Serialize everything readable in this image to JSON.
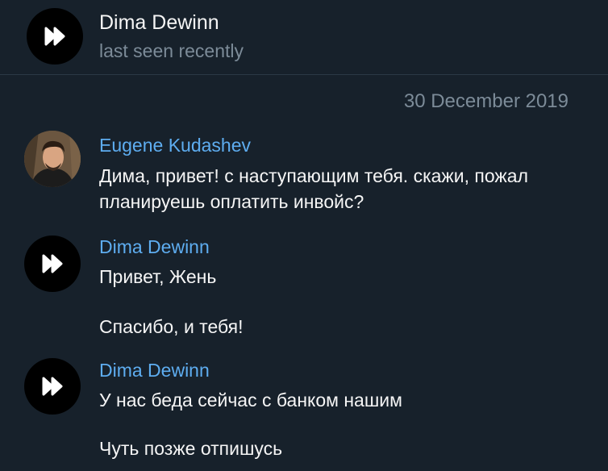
{
  "header": {
    "name": "Dima Dewinn",
    "status": "last seen recently",
    "avatar_icon": "fast-forward-icon"
  },
  "date_separator": "30 December 2019",
  "messages": [
    {
      "sender": "Eugene Kudashev",
      "avatar": "photo",
      "lines": [
        "Дима, привет! с наступающим тебя. скажи, пожал",
        "планируешь оплатить инвойс?"
      ]
    },
    {
      "sender": "Dima Dewinn",
      "avatar_icon": "fast-forward-icon",
      "lines": [
        "Привет, Жень",
        "Спасибо, и тебя!"
      ]
    },
    {
      "sender": "Dima Dewinn",
      "avatar_icon": "fast-forward-icon",
      "lines": [
        "У нас беда сейчас с банком нашим",
        "Чуть позже отпишусь"
      ]
    }
  ],
  "colors": {
    "background": "#17212b",
    "accent": "#5eadf0",
    "muted": "#7c8b98",
    "text": "#f5f5f5"
  }
}
